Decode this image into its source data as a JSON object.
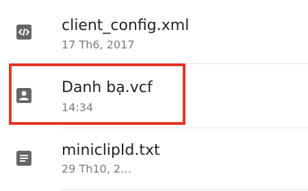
{
  "files": [
    {
      "name": "client_config.xml",
      "meta": "17 Th6, 2017",
      "icon": "code-file-icon"
    },
    {
      "name": "Danh bạ.vcf",
      "meta": "14:34",
      "icon": "contact-card-icon"
    },
    {
      "name": "miniclipId.txt",
      "meta": "29 Th10, 2…",
      "icon": "text-file-icon"
    }
  ],
  "colors": {
    "highlight": "#e53323",
    "icon_bg": "#666666",
    "divider": "#e2e2e2"
  }
}
